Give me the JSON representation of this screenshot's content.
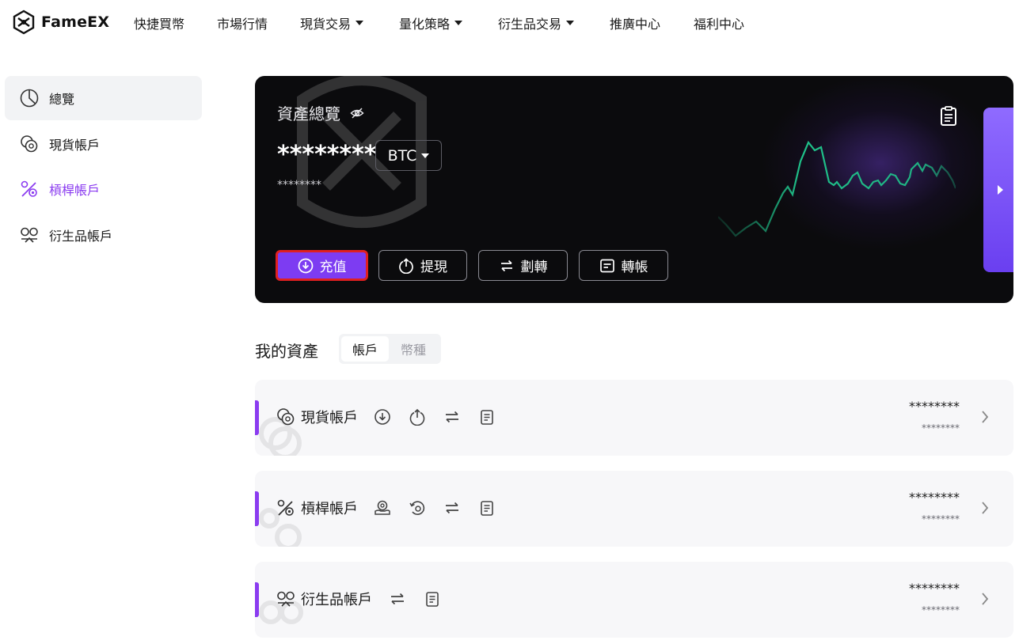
{
  "app": {
    "name": "FameEX"
  },
  "nav": {
    "items": [
      {
        "label": "快捷買幣",
        "dropdown": false
      },
      {
        "label": "市場行情",
        "dropdown": false
      },
      {
        "label": "現貨交易",
        "dropdown": true
      },
      {
        "label": "量化策略",
        "dropdown": true
      },
      {
        "label": "衍生品交易",
        "dropdown": true
      },
      {
        "label": "推廣中心",
        "dropdown": false
      },
      {
        "label": "福利中心",
        "dropdown": false
      }
    ]
  },
  "sidebar": {
    "items": [
      {
        "label": "總覽",
        "icon": "pie-chart-icon",
        "active": true
      },
      {
        "label": "現貨帳戶",
        "icon": "coins-icon",
        "active": false
      },
      {
        "label": "槓桿帳戶",
        "icon": "percent-icon",
        "active": false,
        "highlight": true
      },
      {
        "label": "衍生品帳戶",
        "icon": "derivatives-icon",
        "active": false
      }
    ]
  },
  "overview": {
    "title": "資產總覽",
    "hide_icon": "eye-off-icon",
    "amount": "********",
    "currency": "BTC",
    "sub_amount": "********",
    "record_icon": "document-icon",
    "actions": [
      {
        "label": "充值",
        "icon": "deposit-icon",
        "primary": true
      },
      {
        "label": "提現",
        "icon": "withdraw-icon",
        "primary": false
      },
      {
        "label": "劃轉",
        "icon": "transfer-icon",
        "primary": false
      },
      {
        "label": "轉帳",
        "icon": "send-icon",
        "primary": false
      }
    ],
    "sparkline_color": "#1fc28a"
  },
  "assets": {
    "title": "我的資產",
    "tabs": [
      {
        "label": "帳戶",
        "selected": true
      },
      {
        "label": "幣種",
        "selected": false
      }
    ],
    "accounts": [
      {
        "name": "現貨帳戶",
        "icon": "coins-icon",
        "actions": [
          "deposit-icon",
          "withdraw-icon",
          "transfer-icon",
          "document-icon"
        ],
        "value": "********",
        "sub_value": "********"
      },
      {
        "name": "槓桿帳戶",
        "icon": "percent-icon",
        "actions": [
          "borrow-icon",
          "repay-icon",
          "transfer-icon",
          "document-icon"
        ],
        "value": "********",
        "sub_value": "********"
      },
      {
        "name": "衍生品帳戶",
        "icon": "derivatives-icon",
        "actions": [
          "transfer-icon",
          "document-icon"
        ],
        "value": "********",
        "sub_value": "********"
      }
    ]
  },
  "colors": {
    "accent": "#8b3cf0",
    "primary_button": "#7d3cf2",
    "highlight_border": "#e02020",
    "hero_bg": "#0b0b0d"
  }
}
